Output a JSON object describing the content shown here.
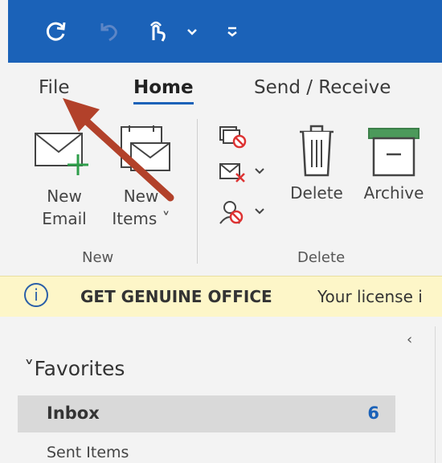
{
  "quick_access": {
    "icons": [
      "sync-icon",
      "undo-icon",
      "touch-mouse-mode-icon",
      "dropdown-chevron-icon",
      "customize-toolbar-icon"
    ]
  },
  "tabs": [
    {
      "label": "File"
    },
    {
      "label": "Home"
    },
    {
      "label": "Send / Receive"
    }
  ],
  "ribbon": {
    "new_group": {
      "label": "New",
      "new_email": {
        "line1": "New",
        "line2": "Email"
      },
      "new_items": {
        "line1": "New",
        "line2": "Items ˅"
      }
    },
    "delete_group": {
      "label": "Delete",
      "delete": "Delete",
      "archive": "Archive"
    }
  },
  "banner": {
    "title": "GET GENUINE OFFICE",
    "message": "Your license i"
  },
  "nav": {
    "collapse_glyph": "‹",
    "favorites_label": "Favorites",
    "favorites_chevron": "˅",
    "inbox_label": "Inbox",
    "inbox_count": "6",
    "sent_label": "Sent Items"
  },
  "colors": {
    "accent": "#1b62b8",
    "arrow": "#b2412a",
    "banner": "#fdf6c8"
  }
}
